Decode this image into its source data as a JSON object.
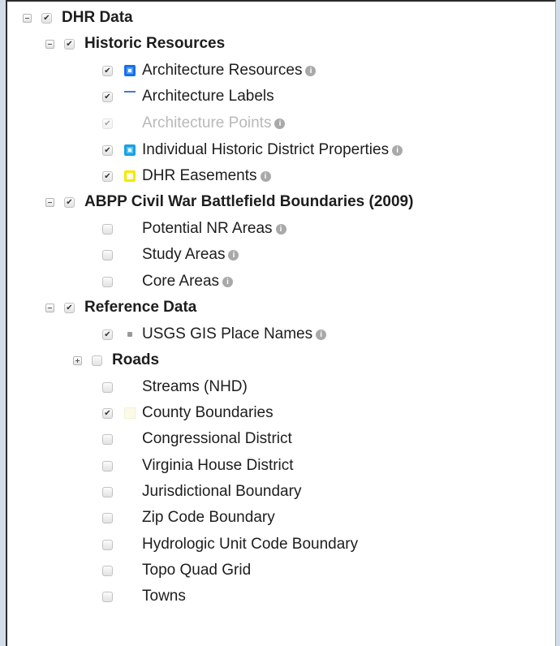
{
  "tree": {
    "dhr_data": "DHR Data",
    "historic_resources": "Historic Resources",
    "architecture_resources": "Architecture Resources",
    "architecture_labels": "Architecture Labels",
    "architecture_points": "Architecture Points",
    "individual_historic": "Individual Historic District Properties",
    "dhr_easements": "DHR Easements",
    "abpp": "ABPP Civil War Battlefield Boundaries (2009)",
    "potential_nr": "Potential NR Areas",
    "study_areas": "Study Areas",
    "core_areas": "Core Areas",
    "reference_data": "Reference Data",
    "usgs": "USGS GIS Place Names",
    "roads": "Roads",
    "streams": "Streams (NHD)",
    "county": "County Boundaries",
    "congressional": "Congressional District",
    "va_house": "Virginia House District",
    "jurisdictional": "Jurisdictional Boundary",
    "zip": "Zip Code Boundary",
    "huc": "Hydrologic Unit Code Boundary",
    "topo": "Topo Quad Grid",
    "towns": "Towns"
  },
  "info_icon_glyph": "i",
  "colors": {
    "background": "#d3dde9",
    "symbol_blue": "#1a6ee6",
    "symbol_cyan": "#1da0e0",
    "symbol_yellow": "#f2ea00"
  }
}
